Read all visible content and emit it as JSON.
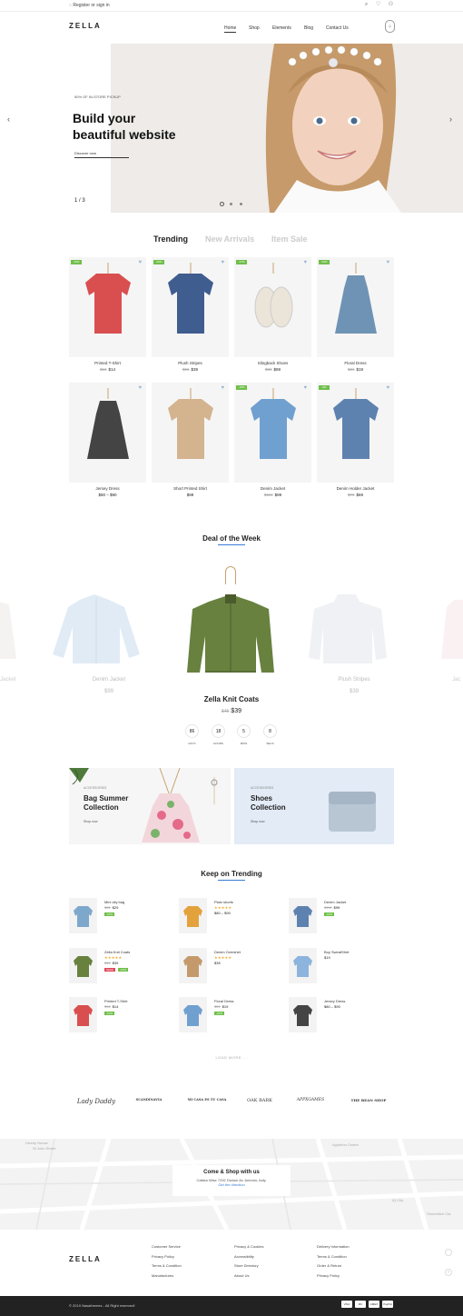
{
  "topbar": {
    "register": "Register or sign in"
  },
  "header": {
    "logo": "ZELLA",
    "nav": [
      "Home",
      "Shop",
      "Elements",
      "Blog",
      "Contact Us"
    ]
  },
  "hero": {
    "eyebrow": "50% OF IN-STORE PICKUP",
    "title_line1": "Build your",
    "title_line2": "beautiful website",
    "cta": "Discover now",
    "counter": "1 / 3"
  },
  "product_tabs": [
    "Trending",
    "New Arrivals",
    "Item Sale"
  ],
  "products": [
    {
      "name": "Printed T-Shirt",
      "old": "$16",
      "price": "$14",
      "badge": "-10%"
    },
    {
      "name": "Plush Stripes",
      "old": "$55",
      "price": "$39",
      "badge": "-29%"
    },
    {
      "name": "Slingback Shoes",
      "old": "$83",
      "price": "$69",
      "badge": "-17%"
    },
    {
      "name": "Floral Dress",
      "old": "$21",
      "price": "$19",
      "badge": "-10%"
    },
    {
      "name": "Jersey Dress",
      "old": "",
      "price": "$80 – $90",
      "badge": ""
    },
    {
      "name": "Short Printed Shirt",
      "old": "",
      "price": "$99",
      "badge": ""
    },
    {
      "name": "Denim Jacket",
      "old": "$110",
      "price": "$99",
      "badge": "-10%"
    },
    {
      "name": "Denim Holder Jacket",
      "old": "$76",
      "price": "$69",
      "badge": "-9%"
    }
  ],
  "deal": {
    "title": "Deal of the Week",
    "side_left": {
      "name": "Denim Jacket",
      "price": "$99"
    },
    "side_right": {
      "name": "Plush Stripes",
      "price": "$39"
    },
    "edge_left": "Jacket",
    "edge_right": "Jac",
    "main_name": "Zella Knit Coats",
    "main_old": "$45",
    "main_price": "$39",
    "countdown": [
      {
        "value": "86",
        "label": "DAYS"
      },
      {
        "value": "18",
        "label": "HOURS"
      },
      {
        "value": "5",
        "label": "MINS"
      },
      {
        "value": "8",
        "label": "SECS"
      }
    ]
  },
  "banners": [
    {
      "eyebrow": "ACCESSORIES",
      "title_line1": "Bag Summer",
      "title_line2": "Collection",
      "cta": "Shop now"
    },
    {
      "eyebrow": "ACCESSORIES",
      "title_line1": "Shoes",
      "title_line2": "Collection",
      "cta": "Shop now"
    }
  ],
  "keep_trending": {
    "title": "Keep on Trending",
    "items": [
      {
        "name": "Mini city bag",
        "old": "$32",
        "price": "$29",
        "stars": "",
        "tags": [
          "-10%"
        ]
      },
      {
        "name": "Plain shorts",
        "old": "",
        "price": "$80 – $90",
        "stars": "★★★★★",
        "tags": []
      },
      {
        "name": "Denim Jacket",
        "old": "$110",
        "price": "$99",
        "stars": "",
        "tags": [
          "-10%"
        ]
      },
      {
        "name": "Zella Knit Coats",
        "old": "$45",
        "price": "$39",
        "stars": "★★★★★",
        "tags": [
          "SALE",
          "-13%"
        ]
      },
      {
        "name": "Denim Overshirt",
        "old": "",
        "price": "$35",
        "stars": "★★★★★",
        "tags": []
      },
      {
        "name": "Boy SweatShirt",
        "old": "",
        "price": "$19",
        "stars": "",
        "tags": []
      },
      {
        "name": "Printed T-Shirt",
        "old": "$16",
        "price": "$14",
        "stars": "",
        "tags": [
          "-10%"
        ]
      },
      {
        "name": "Floral Dress",
        "old": "$21",
        "price": "$19",
        "stars": "",
        "tags": [
          "-10%"
        ]
      },
      {
        "name": "Jersey Dress",
        "old": "",
        "price": "$80 – $90",
        "stars": "",
        "tags": []
      }
    ],
    "load_more": "LOAD MORE ..."
  },
  "brands": [
    "Lady Daddy",
    "SCANDINAVIA",
    "MI CASA ES TU CASA",
    "OAK BARK",
    "APPXGAMES",
    "THE BEAN SHOP"
  ],
  "map_card": {
    "title": "Come & Shop with us",
    "address": "Calista Wise 7292 Dictum Av. Antonio, Italy.",
    "link": "Get the direction",
    "street_labels": [
      "Liberty House",
      "St John Street",
      "Appleton Centre",
      "IQ City",
      "Shoreditch Cla"
    ]
  },
  "footer": {
    "logo": "ZELLA",
    "col1": [
      "Customer Service",
      "Privacy Policy",
      "Terms & Condition",
      "Manufactures"
    ],
    "col2": [
      "Privacy & Cookies",
      "Accessibility",
      "Store Directory",
      "About Us"
    ],
    "col3": [
      "Delivery Information",
      "Terms & Condition",
      "Order & Return",
      "Privacy Policy"
    ],
    "copyright": "© 2019 Nasathemes - All Right reserved!",
    "payments": [
      "VISA",
      "MC",
      "AMEX",
      "PayPal"
    ]
  },
  "colors": {
    "accent": "#3b7bd6",
    "sale_green": "#6fbf4a",
    "sale_red": "#e0475b",
    "heart": "#9bb5d6"
  }
}
